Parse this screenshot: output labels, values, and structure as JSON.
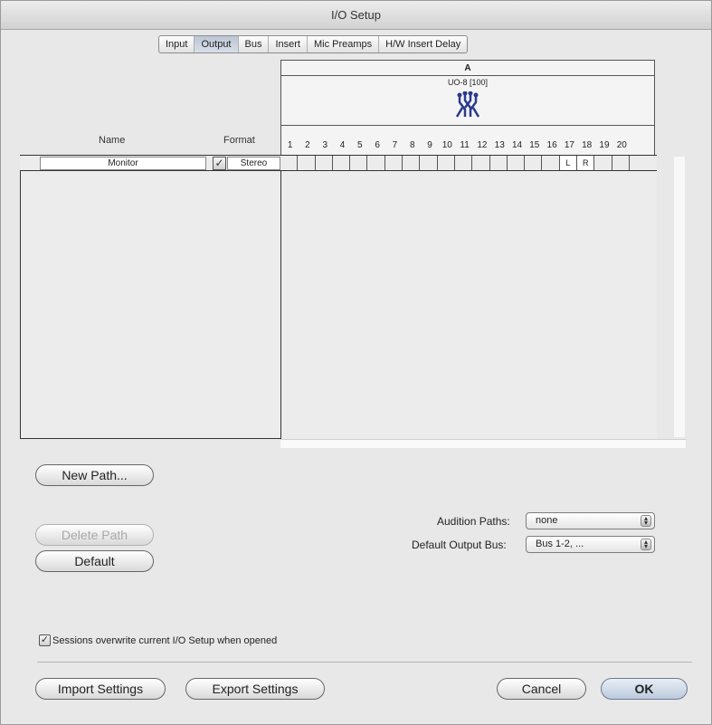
{
  "window": {
    "title": "I/O Setup"
  },
  "tabs": [
    {
      "label": "Input",
      "active": false
    },
    {
      "label": "Output",
      "active": true
    },
    {
      "label": "Bus",
      "active": false
    },
    {
      "label": "Insert",
      "active": false
    },
    {
      "label": "Mic Preamps",
      "active": false
    },
    {
      "label": "H/W Insert Delay",
      "active": false
    }
  ],
  "grid": {
    "group_letter": "A",
    "device_label": "UO-8 [100]",
    "device_icon": "interface-icon",
    "channels": [
      "1",
      "2",
      "3",
      "4",
      "5",
      "6",
      "7",
      "8",
      "9",
      "10",
      "11",
      "12",
      "13",
      "14",
      "15",
      "16",
      "17",
      "18",
      "19",
      "20"
    ]
  },
  "columns": {
    "name": "Name",
    "format": "Format"
  },
  "paths": [
    {
      "name": "Monitor",
      "checked": true,
      "format": "Stereo",
      "assignments": [
        "",
        "",
        "",
        "",
        "",
        "",
        "",
        "",
        "",
        "",
        "",
        "",
        "",
        "",
        "",
        "",
        "L",
        "R",
        "",
        ""
      ]
    }
  ],
  "buttons": {
    "new_path": "New Path...",
    "delete_path": "Delete Path",
    "default": "Default",
    "import": "Import Settings",
    "export": "Export Settings",
    "cancel": "Cancel",
    "ok": "OK"
  },
  "audition": {
    "label": "Audition Paths:",
    "value": "none"
  },
  "default_output": {
    "label": "Default Output Bus:",
    "value": "Bus 1-2, ..."
  },
  "sessions_checkbox": {
    "label": "Sessions overwrite current I/O Setup when opened",
    "checked": true
  },
  "colors": {
    "accent": "#2a3a8c",
    "selected_tab": "#bcc6d4"
  }
}
